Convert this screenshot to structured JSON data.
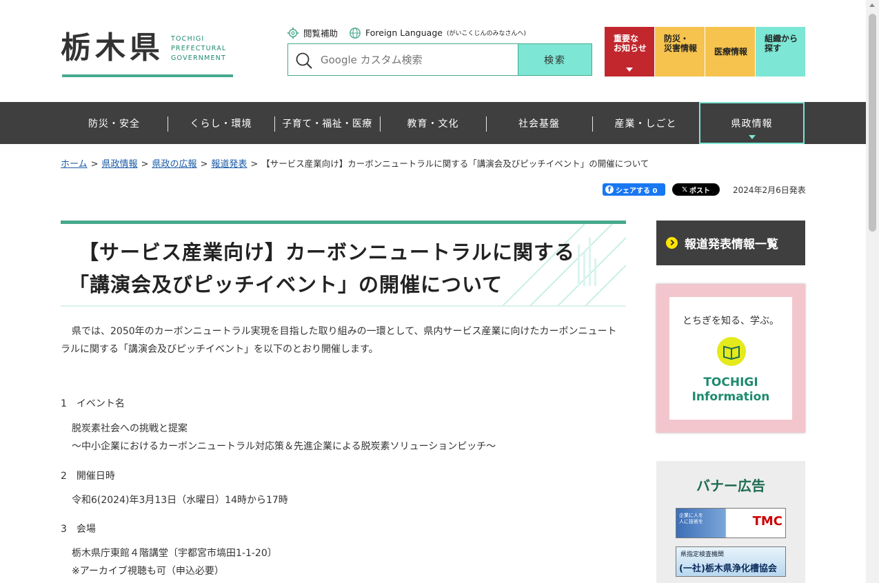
{
  "header": {
    "logo_text": "栃木県",
    "logo_sub": [
      "TOCHIGI",
      "PREFECTURAL",
      "GOVERNMENT"
    ],
    "accessibility_label": "閲覧補助",
    "language_label": "Foreign Language",
    "language_note": "(がいこくじんのみなさんへ)",
    "search_placeholder": "Google カスタム検索",
    "search_button": "検索",
    "quick": [
      {
        "label": "重要な\nお知らせ"
      },
      {
        "label": "防災・\n災害情報"
      },
      {
        "label": "医療情報"
      },
      {
        "label": "組織から\n探す"
      }
    ]
  },
  "nav": {
    "items": [
      "防災・安全",
      "くらし・環境",
      "子育て・福祉・医療",
      "教育・文化",
      "社会基盤",
      "産業・しごと",
      "県政情報"
    ],
    "active_index": 6
  },
  "breadcrumb": {
    "links": [
      "ホーム",
      "県政情報",
      "県政の広報",
      "報道発表"
    ],
    "current": "【サービス産業向け】カーボンニュートラルに関する「講演会及びピッチイベント」の開催について"
  },
  "social": {
    "facebook_label": "シェアする 0",
    "x_label": "ポスト",
    "date": "2024年2月6日発表"
  },
  "article": {
    "title_line1": "【サービス産業向け】カーボンニュートラルに関する",
    "title_line2": "「講演会及びピッチイベント」の開催について",
    "intro": "県では、2050年のカーボンニュートラル実現を目指した取り組みの一環として、県内サービス産業に向けたカーボンニュートラルに関する「講演会及びピッチイベント」を以下のとおり開催します。",
    "sections": [
      {
        "heading": "1　イベント名",
        "lines": [
          "脱炭素社会への挑戦と提案",
          "～中小企業におけるカーボンニュートラル対応策＆先進企業による脱炭素ソリューションピッチ～"
        ]
      },
      {
        "heading": "2　開催日時",
        "lines": [
          "令和6(2024)年3月13日（水曜日）14時から17時"
        ]
      },
      {
        "heading": "3　会場",
        "lines": [
          "栃木県庁東館４階講堂〔宇都宮市塙田1-1-20〕",
          "※アーカイブ視聴も可（申込必要）"
        ]
      }
    ]
  },
  "sidebar": {
    "press_link": "報道発表情報一覧",
    "info_tagline": "とちぎを知る、学ぶ。",
    "info_name_1": "TOCHIGI",
    "info_name_2": "Information",
    "banner_heading": "バナー広告",
    "ad1_text": "TMC",
    "ad1_small": "企業に人を\n人に技術を",
    "ad2_line1": "県指定検査機関",
    "ad2_line2": "(一社)栃木県浄化槽協会"
  },
  "colors": {
    "brand_green": "#47a88d",
    "accent_teal": "#7de6d4",
    "alert_red": "#c1272d",
    "info_orange": "#f5c34e",
    "nav_dark": "#3f3f3f"
  }
}
